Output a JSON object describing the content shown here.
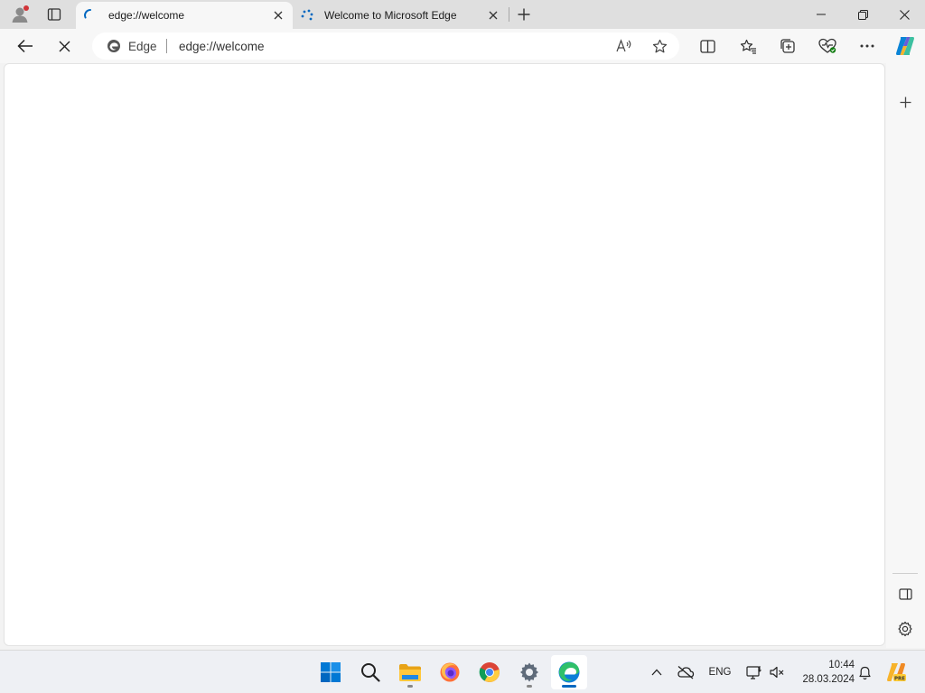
{
  "tabs": [
    {
      "title": "edge://welcome",
      "active": true,
      "loading": true
    },
    {
      "title": "Welcome to Microsoft Edge",
      "active": false,
      "loading": true
    }
  ],
  "address_bar": {
    "site_label": "Edge",
    "url": "edge://welcome"
  },
  "taskbar": {
    "pinned": [
      "start-icon",
      "search-icon",
      "file-explorer-icon",
      "firefox-icon",
      "chrome-icon",
      "settings-icon",
      "edge-icon"
    ],
    "active": "edge-icon",
    "language": "ENG",
    "time": "10:44",
    "date": "28.03.2024"
  },
  "colors": {
    "accent": "#0067c0",
    "titlebar": "#dfdfdf",
    "toolbar": "#f7f7f7"
  }
}
